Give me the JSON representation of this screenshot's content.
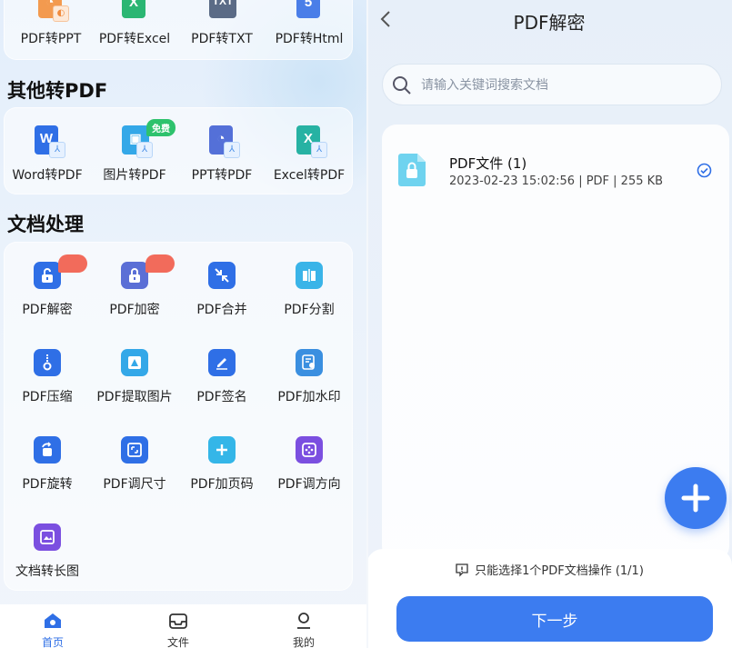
{
  "left": {
    "top_row": [
      {
        "label": "PDF转PPT",
        "icon": "ppt-file-icon",
        "color": "#f08a3c"
      },
      {
        "label": "PDF转Excel",
        "icon": "excel-file-icon",
        "color": "#2bb673"
      },
      {
        "label": "PDF转TXT",
        "icon": "txt-file-icon",
        "color": "#5b6b86"
      },
      {
        "label": "PDF转Html",
        "icon": "html-file-icon",
        "color": "#4a7ee8"
      }
    ],
    "other_to_pdf": {
      "title": "其他转PDF",
      "items": [
        {
          "label": "Word转PDF",
          "icon": "word-to-pdf-icon",
          "color": "#2f6fe6",
          "glyph": "W"
        },
        {
          "label": "图片转PDF",
          "icon": "image-to-pdf-icon",
          "color": "#34a8e8",
          "glyph": "▣",
          "badge": "免费"
        },
        {
          "label": "PPT转PDF",
          "icon": "ppt-to-pdf-icon",
          "color": "#5470d8",
          "glyph": "◔"
        },
        {
          "label": "Excel转PDF",
          "icon": "excel-to-pdf-icon",
          "color": "#27b2a3",
          "glyph": "X"
        }
      ]
    },
    "doc_processing": {
      "title": "文档处理",
      "items": [
        {
          "label": "PDF解密",
          "icon": "unlock-icon",
          "color": "#2f6fe6",
          "tag": true
        },
        {
          "label": "PDF加密",
          "icon": "lock-icon",
          "color": "#5b6fd6",
          "tag": true
        },
        {
          "label": "PDF合并",
          "icon": "merge-icon",
          "color": "#2f6fe6"
        },
        {
          "label": "PDF分割",
          "icon": "split-icon",
          "color": "#3ab4e8"
        },
        {
          "label": "PDF压缩",
          "icon": "zip-icon",
          "color": "#2f6fe6"
        },
        {
          "label": "PDF提取图片",
          "icon": "extract-image-icon",
          "color": "#34a8e8"
        },
        {
          "label": "PDF签名",
          "icon": "signature-icon",
          "color": "#2f6fe6"
        },
        {
          "label": "PDF加水印",
          "icon": "watermark-icon",
          "color": "#3a8fe0"
        },
        {
          "label": "PDF旋转",
          "icon": "rotate-icon",
          "color": "#2f6fe6"
        },
        {
          "label": "PDF调尺寸",
          "icon": "resize-icon",
          "color": "#2f6fe6"
        },
        {
          "label": "PDF加页码",
          "icon": "page-number-icon",
          "color": "#34b6e8"
        },
        {
          "label": "PDF调方向",
          "icon": "orientation-icon",
          "color": "#7b4fe0"
        },
        {
          "label": "文档转长图",
          "icon": "long-image-icon",
          "color": "#7b4fe0"
        }
      ]
    },
    "nav": [
      {
        "label": "首页",
        "icon": "home-icon",
        "active": true
      },
      {
        "label": "文件",
        "icon": "inbox-icon",
        "active": false
      },
      {
        "label": "我的",
        "icon": "user-icon",
        "active": false
      }
    ]
  },
  "right": {
    "title": "PDF解密",
    "search_placeholder": "请输入关键词搜索文档",
    "file": {
      "name": "PDF文件 (1)",
      "meta": "2023-02-23 15:02:56   | PDF | 255 KB",
      "selected": true
    },
    "hint": "只能选择1个PDF文档操作 (1/1)",
    "next_label": "下一步"
  },
  "colors": {
    "accent": "#3c7cf0",
    "tag_red": "#f26b5b",
    "free_green": "#2ec26d"
  }
}
